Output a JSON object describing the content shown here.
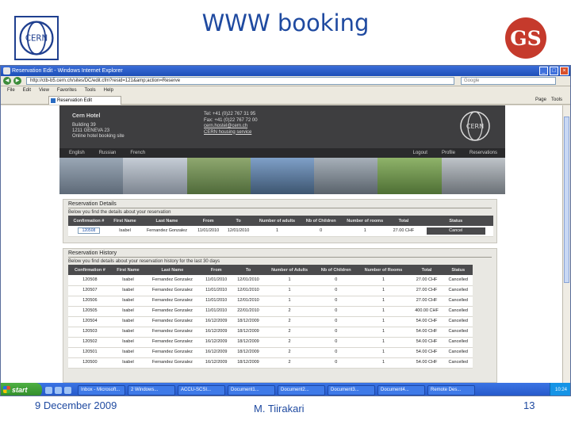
{
  "slide": {
    "title": "WWW booking",
    "footer_date": "9 December 2009",
    "footer_author": "M. Tiirakari",
    "page_number": "13",
    "gs_logo_text": "GS",
    "cern_logo_text": "CERN",
    "accent_color": "#1f4aa0"
  },
  "browser": {
    "window_title": "Reservation Edit - Windows Internet Explorer",
    "address": "http://ctb-b5.cern.ch/sites/DC/edit.cfm?resid=121&amp;action=Reserve",
    "search_placeholder": "Google",
    "menu": [
      "File",
      "Edit",
      "View",
      "Favorites",
      "Tools",
      "Help"
    ],
    "tab_label": "Reservation Edit",
    "page_tools": [
      "Page",
      "Tools"
    ]
  },
  "hotel": {
    "name": "Cern Hotel",
    "address_lines": [
      "Building 39",
      "1211 GENEVA 23",
      "Online hotel booking site"
    ],
    "contact_lines": [
      "Tel: +41 (0)22 767 31 95",
      "Fax: +41 (0)22 767 72 00",
      "cern.hostel@cern.ch",
      "CERN housing service"
    ],
    "languages": [
      "English",
      "Russian",
      "French"
    ],
    "nav_links": [
      "Logout",
      "Profile",
      "Reservations"
    ],
    "logo_text": "CERN"
  },
  "reservation_details": {
    "title": "Reservation Details",
    "subtitle": "Below you find the details about your reservation",
    "columns": [
      "Confirmation #",
      "First Name",
      "Last Name",
      "From",
      "To",
      "Number of adults",
      "Nb of Children",
      "Number of rooms",
      "Total",
      "Status"
    ],
    "row": {
      "confirmation": "120508",
      "first_name": "Isabel",
      "last_name": "Fernandez Gonzalez",
      "from": "11/01/2010",
      "to": "12/01/2010",
      "adults": "1",
      "children": "0",
      "rooms": "1",
      "total": "27.00 CHF",
      "action": "Cancel"
    }
  },
  "reservation_history": {
    "title": "Reservation History",
    "subtitle": "Below you find details about your reservation history for the last 30 days",
    "columns": [
      "Confirmation #",
      "First Name",
      "Last Name",
      "From",
      "To",
      "Number of Adults",
      "Nb of Children",
      "Number of Rooms",
      "Total",
      "Status"
    ],
    "rows": [
      {
        "confirmation": "120508",
        "first_name": "Isabel",
        "last_name": "Fernandez Gonzalez",
        "from": "11/01/2010",
        "to": "12/01/2010",
        "adults": "1",
        "children": "0",
        "rooms": "1",
        "total": "27.00 CHF",
        "status": "Cancelled"
      },
      {
        "confirmation": "120507",
        "first_name": "Isabel",
        "last_name": "Fernandez Gonzalez",
        "from": "11/01/2010",
        "to": "12/01/2010",
        "adults": "1",
        "children": "0",
        "rooms": "1",
        "total": "27.00 CHF",
        "status": "Cancelled"
      },
      {
        "confirmation": "120506",
        "first_name": "Isabel",
        "last_name": "Fernandez Gonzalez",
        "from": "11/01/2010",
        "to": "12/01/2010",
        "adults": "1",
        "children": "0",
        "rooms": "1",
        "total": "27.00 CHF",
        "status": "Cancelled"
      },
      {
        "confirmation": "120505",
        "first_name": "Isabel",
        "last_name": "Fernandez Gonzalez",
        "from": "11/01/2010",
        "to": "22/01/2010",
        "adults": "2",
        "children": "0",
        "rooms": "1",
        "total": "400.00 CHF",
        "status": "Cancelled"
      },
      {
        "confirmation": "120504",
        "first_name": "Isabel",
        "last_name": "Fernandez Gonzalez",
        "from": "16/12/2009",
        "to": "18/12/2009",
        "adults": "2",
        "children": "0",
        "rooms": "1",
        "total": "54.00 CHF",
        "status": "Cancelled"
      },
      {
        "confirmation": "120503",
        "first_name": "Isabel",
        "last_name": "Fernandez Gonzalez",
        "from": "16/12/2009",
        "to": "18/12/2009",
        "adults": "2",
        "children": "0",
        "rooms": "1",
        "total": "54.00 CHF",
        "status": "Cancelled"
      },
      {
        "confirmation": "120502",
        "first_name": "Isabel",
        "last_name": "Fernandez Gonzalez",
        "from": "16/12/2009",
        "to": "18/12/2009",
        "adults": "2",
        "children": "0",
        "rooms": "1",
        "total": "54.00 CHF",
        "status": "Cancelled"
      },
      {
        "confirmation": "120501",
        "first_name": "Isabel",
        "last_name": "Fernandez Gonzalez",
        "from": "16/12/2009",
        "to": "18/12/2009",
        "adults": "2",
        "children": "0",
        "rooms": "1",
        "total": "54.00 CHF",
        "status": "Cancelled"
      },
      {
        "confirmation": "120500",
        "first_name": "Isabel",
        "last_name": "Fernandez Gonzalez",
        "from": "16/12/2009",
        "to": "18/12/2009",
        "adults": "2",
        "children": "0",
        "rooms": "1",
        "total": "54.00 CHF",
        "status": "Cancelled"
      }
    ]
  },
  "taskbar": {
    "start_label": "start",
    "tasks": [
      "Inbox - Microsoft...",
      "2 Windows...",
      "ACCU-SCSI...",
      "Document1...",
      "Document2...",
      "Document3...",
      "Document4...",
      "Remote Des..."
    ],
    "clock": "10:24"
  }
}
